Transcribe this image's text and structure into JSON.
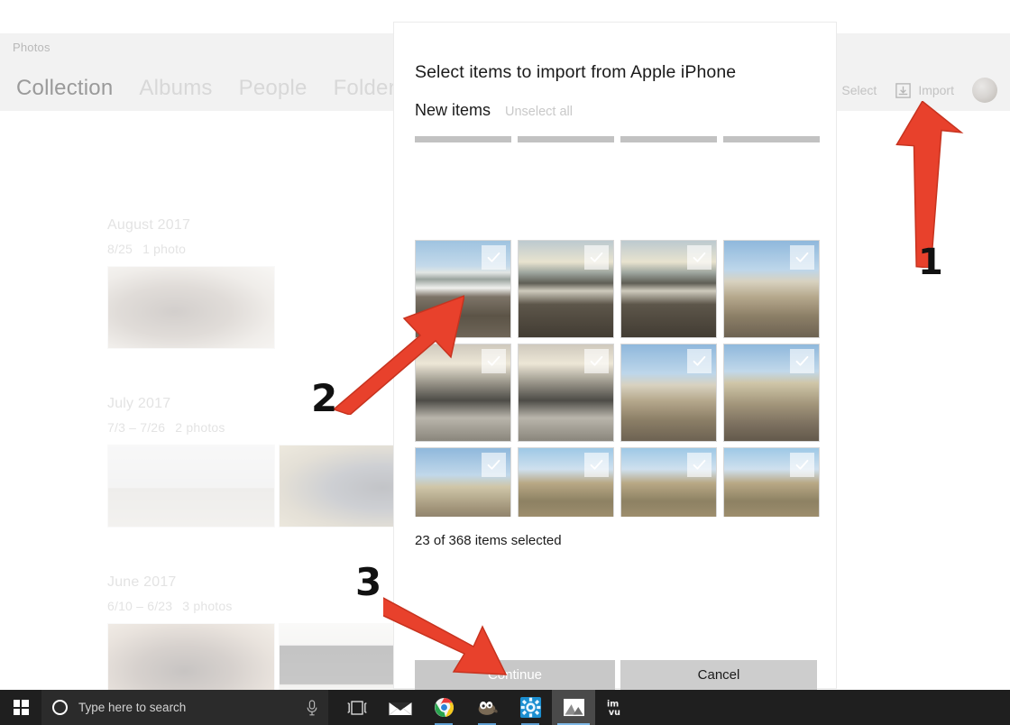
{
  "app": {
    "name": "Photos",
    "nav": [
      {
        "label": "Collection",
        "active": true
      },
      {
        "label": "Albums",
        "active": false
      },
      {
        "label": "People",
        "active": false
      },
      {
        "label": "Folders",
        "active": false
      }
    ],
    "toolbar": {
      "select_label": "Select",
      "select_icon": "select-icon",
      "import_label": "Import",
      "import_icon": "import-tray-icon",
      "avatar_icon": "account-avatar"
    }
  },
  "collection": {
    "groups": [
      {
        "title": "August 2017",
        "dates": "8/25",
        "count": "1 photo",
        "thumbs": [
          "ph-teen"
        ]
      },
      {
        "title": "July 2017",
        "dates": "7/3 – 7/26",
        "count": "2 photos",
        "thumbs": [
          "ph-light",
          "ph-girls"
        ]
      },
      {
        "title": "June 2017",
        "dates": "6/10 – 6/23",
        "count": "3 photos",
        "thumbs": [
          "ph-boy",
          "ph-cat"
        ]
      }
    ]
  },
  "dialog": {
    "title": "Select items to import from Apple iPhone",
    "subtitle": "New items",
    "unselect_all_label": "Unselect all",
    "status": "23 of 368 items selected",
    "continue_label": "Continue",
    "cancel_label": "Cancel",
    "selected_count": 23,
    "total_count": 368,
    "check_icon": "checkmark-icon",
    "thumbnails": [
      {
        "row": 0,
        "style": "pa",
        "partial": true,
        "checked": false
      },
      {
        "row": 0,
        "style": "pa",
        "partial": true,
        "checked": false
      },
      {
        "row": 0,
        "style": "pa",
        "partial": true,
        "checked": false
      },
      {
        "row": 0,
        "style": "pa",
        "partial": true,
        "checked": false
      },
      {
        "row": 1,
        "style": "pa",
        "partial": false,
        "checked": true
      },
      {
        "row": 1,
        "style": "pb",
        "partial": false,
        "checked": true
      },
      {
        "row": 1,
        "style": "pb",
        "partial": false,
        "checked": true
      },
      {
        "row": 1,
        "style": "pc",
        "partial": false,
        "checked": true
      },
      {
        "row": 2,
        "style": "ph",
        "partial": false,
        "checked": true
      },
      {
        "row": 2,
        "style": "ph",
        "partial": false,
        "checked": true
      },
      {
        "row": 2,
        "style": "pc",
        "partial": false,
        "checked": true
      },
      {
        "row": 2,
        "style": "pd",
        "partial": false,
        "checked": true
      },
      {
        "row": 3,
        "style": "pd",
        "partial": false,
        "checked": true
      },
      {
        "row": 3,
        "style": "pe",
        "partial": false,
        "checked": true
      },
      {
        "row": 3,
        "style": "pe",
        "partial": false,
        "checked": true
      },
      {
        "row": 3,
        "style": "pe",
        "partial": false,
        "checked": true
      },
      {
        "row": 4,
        "style": "pg",
        "partial": false,
        "checked": true
      },
      {
        "row": 4,
        "style": "pg",
        "partial": false,
        "checked": true
      },
      {
        "row": 4,
        "style": "pf",
        "partial": false,
        "checked": true
      },
      {
        "row": 4,
        "style": "pf",
        "partial": false,
        "checked": true
      }
    ]
  },
  "annotations": {
    "color": "#e8412c",
    "steps": [
      {
        "number": "1",
        "target": "import-button"
      },
      {
        "number": "2",
        "target": "photo-grid"
      },
      {
        "number": "3",
        "target": "continue-button"
      }
    ]
  },
  "taskbar": {
    "start_icon": "windows-start-icon",
    "cortana_icon": "cortana-ring-icon",
    "search_placeholder": "Type here to search",
    "mic_icon": "microphone-icon",
    "items": [
      {
        "name": "task-view-icon",
        "label": "Task View"
      },
      {
        "name": "mail-icon",
        "label": "Mail"
      },
      {
        "name": "chrome-icon",
        "label": "Google Chrome"
      },
      {
        "name": "gimp-icon",
        "label": "GIMP"
      },
      {
        "name": "settings-app-icon",
        "label": "Settings"
      },
      {
        "name": "photos-icon",
        "label": "Photos"
      },
      {
        "name": "imvu-icon",
        "label": "IMVU"
      }
    ]
  }
}
